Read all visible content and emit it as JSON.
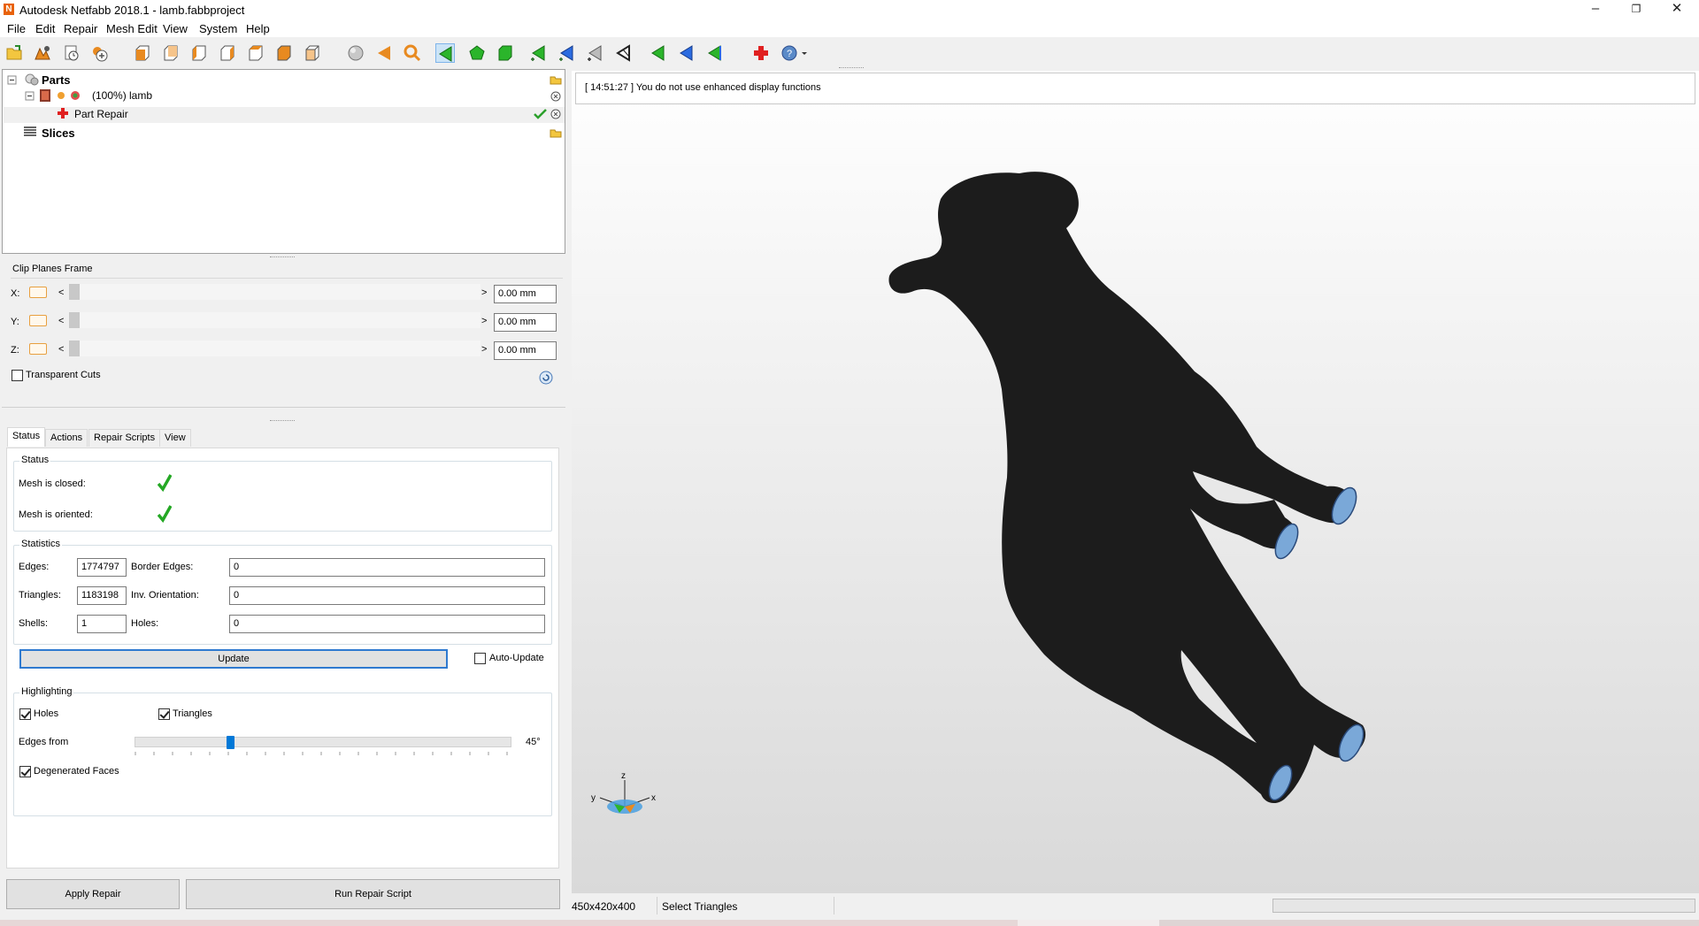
{
  "window": {
    "title": "Autodesk Netfabb 2018.1 - lamb.fabbproject",
    "app_icon_letter": "N",
    "minimize": "–",
    "maximize": "❐",
    "close": "✕"
  },
  "menu": [
    "File",
    "Edit",
    "Repair",
    "Mesh Edit",
    "View",
    "System",
    "Help"
  ],
  "toolbar": {
    "icons": [
      "open-project-icon",
      "add-part-icon",
      "import-icon",
      "add-icon",
      "view-front-icon",
      "view-back-icon",
      "view-left-icon",
      "view-right-icon",
      "view-top-icon",
      "view-bottom-icon",
      "view-iso-icon",
      "sphere-icon",
      "arrow-left-icon",
      "zoom-icon",
      "select-triangle-icon",
      "select-surface-icon",
      "select-shell-icon",
      "select-mode-1-icon",
      "select-mode-2-icon",
      "select-mode-3-icon",
      "select-mode-4-icon",
      "nav-1-icon",
      "nav-2-icon",
      "nav-3-icon",
      "repair-cross-icon",
      "help-dropdown-icon"
    ]
  },
  "tree": {
    "parts_label": "Parts",
    "part_label": "(100%) lamb",
    "repair_label": "Part Repair",
    "slices_label": "Slices"
  },
  "clip": {
    "caption": "Clip Planes Frame",
    "axes": [
      {
        "label": "X:",
        "value": "0.00 mm"
      },
      {
        "label": "Y:",
        "value": "0.00 mm"
      },
      {
        "label": "Z:",
        "value": "0.00 mm"
      }
    ],
    "left_arrow": "<",
    "right_arrow": ">",
    "transparent_label": "Transparent Cuts",
    "transparent_checked": false
  },
  "tabs": [
    "Status",
    "Actions",
    "Repair Scripts",
    "View"
  ],
  "status": {
    "caption": "Status",
    "closed_label": "Mesh is closed:",
    "oriented_label": "Mesh is oriented:"
  },
  "statistics": {
    "caption": "Statistics",
    "edges_label": "Edges:",
    "edges": "1774797",
    "border_label": "Border Edges:",
    "border": "0",
    "triangles_label": "Triangles:",
    "triangles": "1183198",
    "inv_label": "Inv. Orientation:",
    "inv": "0",
    "shells_label": "Shells:",
    "shells": "1",
    "holes_label": "Holes:",
    "holes": "0",
    "update_label": "Update",
    "autoupdate_label": "Auto-Update",
    "autoupdate_checked": false
  },
  "highlighting": {
    "caption": "Highlighting",
    "holes_label": "Holes",
    "holes_checked": true,
    "triangles_label": "Triangles",
    "triangles_checked": true,
    "edges_from_label": "Edges from",
    "edges_from_value": "45°",
    "edges_from_fraction": 0.25,
    "degenerated_label": "Degenerated Faces",
    "degenerated_checked": true
  },
  "buttons": {
    "apply_repair": "Apply Repair",
    "run_script": "Run Repair Script"
  },
  "viewport": {
    "message": "[ 14:51:27 ] You do not use enhanced display functions",
    "axis_x": "x",
    "axis_y": "y",
    "axis_z": "z"
  },
  "statusbar": {
    "dimensions": "450x420x400",
    "mode": "Select Triangles"
  }
}
